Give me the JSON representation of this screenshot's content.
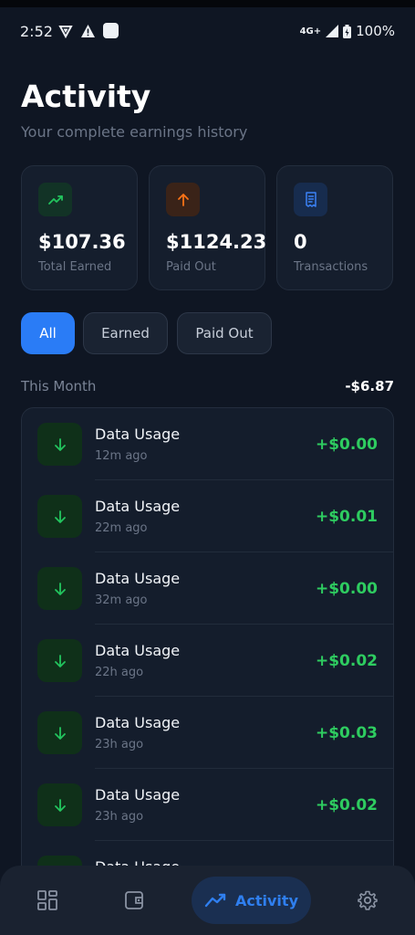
{
  "status": {
    "time": "2:52",
    "network": "4G+",
    "battery": "100%"
  },
  "header": {
    "title": "Activity",
    "subtitle": "Your complete earnings history"
  },
  "stats": [
    {
      "value": "$107.36",
      "label": "Total Earned",
      "icon": "trending-up-icon",
      "color": "#22c55e"
    },
    {
      "value": "$1124.23",
      "label": "Paid Out",
      "icon": "arrow-up-icon",
      "color": "#f97316"
    },
    {
      "value": "0",
      "label": "Transactions",
      "icon": "receipt-icon",
      "color": "#3b82f6"
    }
  ],
  "filters": [
    {
      "label": "All",
      "active": true
    },
    {
      "label": "Earned",
      "active": false
    },
    {
      "label": "Paid Out",
      "active": false
    }
  ],
  "section": {
    "label": "This Month",
    "total": "-$6.87"
  },
  "transactions": [
    {
      "title": "Data Usage",
      "time": "12m ago",
      "amount": "+$0.00"
    },
    {
      "title": "Data Usage",
      "time": "22m ago",
      "amount": "+$0.01"
    },
    {
      "title": "Data Usage",
      "time": "32m ago",
      "amount": "+$0.00"
    },
    {
      "title": "Data Usage",
      "time": "22h ago",
      "amount": "+$0.02"
    },
    {
      "title": "Data Usage",
      "time": "23h ago",
      "amount": "+$0.03"
    },
    {
      "title": "Data Usage",
      "time": "23h ago",
      "amount": "+$0.02"
    },
    {
      "title": "Data Usage",
      "time": "",
      "amount": ""
    }
  ],
  "nav": {
    "items": [
      {
        "icon": "dashboard-icon"
      },
      {
        "icon": "wallet-icon"
      },
      {
        "icon": "activity-icon",
        "label": "Activity",
        "active": true
      },
      {
        "icon": "settings-gear-icon"
      }
    ]
  },
  "colors": {
    "accent": "#2a7cf6",
    "positive": "#2ecc60",
    "background": "#0f1623"
  }
}
